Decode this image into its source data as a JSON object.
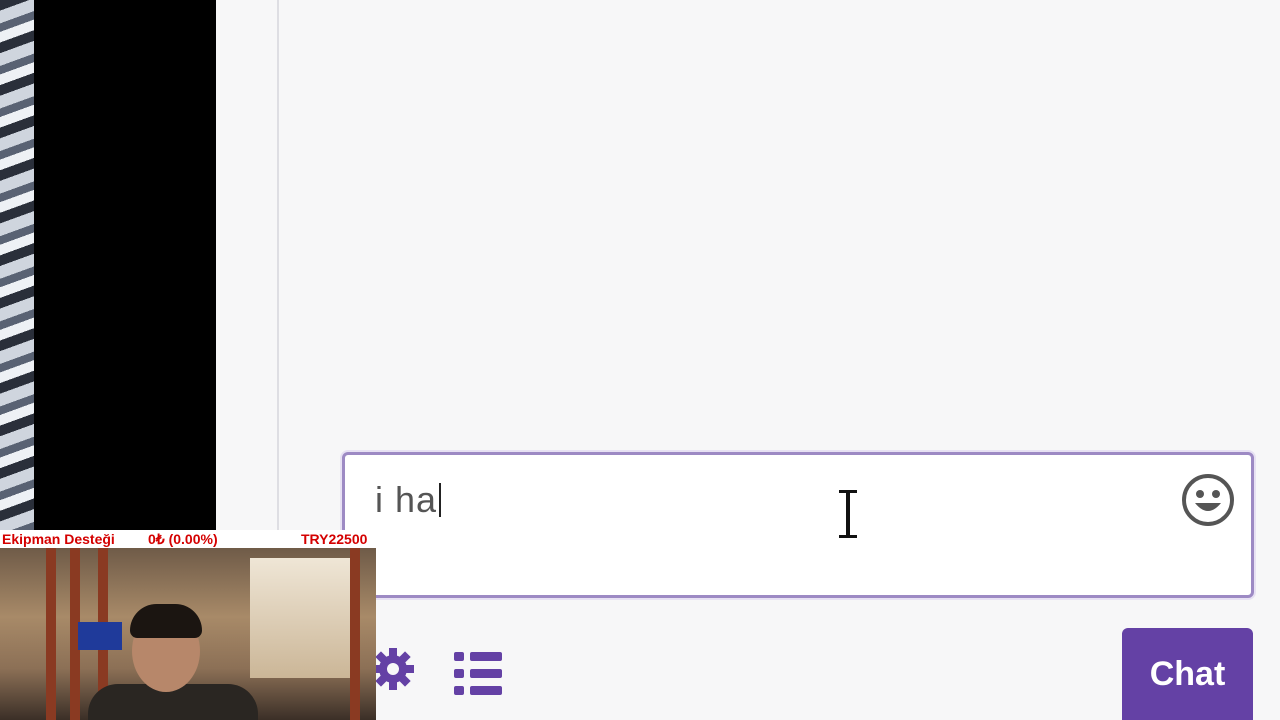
{
  "chat": {
    "input_value": "i ha",
    "send_label": "Chat",
    "icons": {
      "emoji": "emoji-smile-icon",
      "settings": "gear-icon",
      "list": "list-icon",
      "cursor": "text-cursor-icon"
    },
    "accent_color": "#6441a5"
  },
  "overlay": {
    "title": "Ekipman Desteği",
    "progress": "0₺ (0.00%)",
    "goal": "TRY22500"
  }
}
